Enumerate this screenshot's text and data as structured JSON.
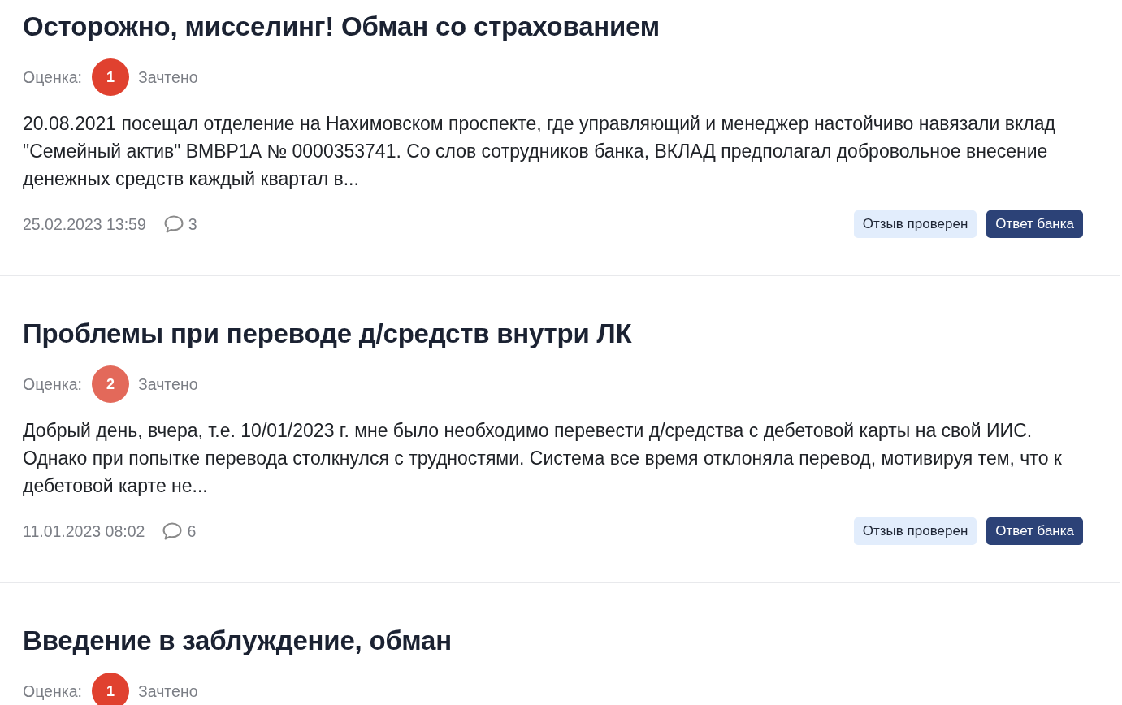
{
  "reviews": [
    {
      "title": "Осторожно, мисселинг! Обман со страхованием",
      "rating": {
        "label": "Оценка:",
        "grade": "1",
        "color": "#e0412f",
        "status": "Зачтено"
      },
      "text": "20.08.2021 посещал отделение на Нахимовском проспекте, где управляющий и менеджер настойчиво навязали вклад \"Семейный актив\" ВМВР1А № 0000353741. Со слов сотрудников банка, ВКЛАД предполагал добровольное внесение денежных средств каждый квартал в...",
      "date": "25.02.2023 13:59",
      "comments": "3",
      "badges": [
        {
          "kind": "verified",
          "label": "Отзыв проверен"
        },
        {
          "kind": "bank_reply",
          "label": "Ответ банка"
        }
      ]
    },
    {
      "title": "Проблемы при переводе д/средств внутри ЛК",
      "rating": {
        "label": "Оценка:",
        "grade": "2",
        "color": "#e3695a",
        "status": "Зачтено"
      },
      "text": "Добрый день, вчера, т.е. 10/01/2023 г. мне было необходимо перевести д/средства с дебетовой карты на свой ИИС. Однако при попытке перевода столкнулся с трудностями. Система все время отклоняла перевод, мотивируя тем, что к дебетовой карте не...",
      "date": "11.01.2023 08:02",
      "comments": "6",
      "badges": [
        {
          "kind": "verified",
          "label": "Отзыв проверен"
        },
        {
          "kind": "bank_reply",
          "label": "Ответ банка"
        }
      ]
    },
    {
      "title": "Введение в заблуждение, обман",
      "rating": {
        "label": "Оценка:",
        "grade": "1",
        "color": "#e0412f",
        "status": "Зачтено"
      }
    }
  ]
}
